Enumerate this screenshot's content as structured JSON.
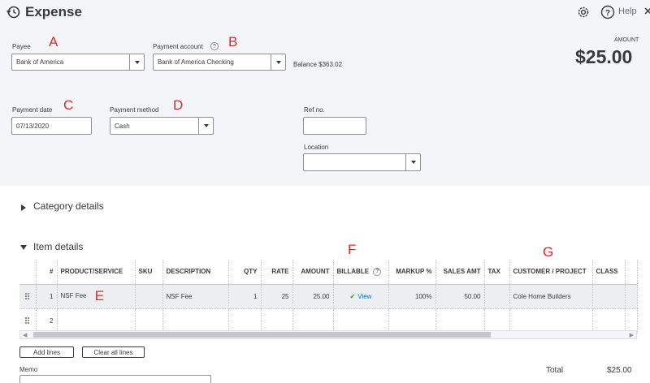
{
  "header": {
    "title": "Expense",
    "help_label": "Help",
    "icons": [
      "history-icon",
      "gear-icon",
      "help-icon",
      "close-icon"
    ]
  },
  "payee": {
    "label": "Payee",
    "value": "Bank of America"
  },
  "payment_account": {
    "label": "Payment account",
    "value": "Bank of America Checking",
    "help": "?"
  },
  "balance": "Balance $363.02",
  "amount": {
    "label": "AMOUNT",
    "value": "$25.00"
  },
  "payment_date": {
    "label": "Payment date",
    "value": "07/13/2020"
  },
  "payment_method": {
    "label": "Payment method",
    "value": "Cash"
  },
  "ref_no": {
    "label": "Ref no.",
    "value": ""
  },
  "location": {
    "label": "Location",
    "value": ""
  },
  "annotations": {
    "a": "A",
    "b": "B",
    "c": "C",
    "d": "D",
    "e": "E",
    "f": "F",
    "g": "G"
  },
  "category_details": {
    "title": "Category details"
  },
  "item_details": {
    "title": "Item details",
    "columns": [
      "#",
      "PRODUCT/SERVICE",
      "SKU",
      "DESCRIPTION",
      "QTY",
      "RATE",
      "AMOUNT",
      "BILLABLE",
      "MARKUP %",
      "SALES AMT",
      "TAX",
      "CUSTOMER / PROJECT",
      "CLASS"
    ],
    "billable_help": "?",
    "rows": [
      {
        "num": "1",
        "product": "NSF Fee",
        "sku": "",
        "description": "NSF Fee",
        "qty": "1",
        "rate": "25",
        "amount": "25.00",
        "billable": "View",
        "markup": "100%",
        "sales_amt": "50.00",
        "tax": "",
        "customer": "Cole Home Builders",
        "class": ""
      },
      {
        "num": "2",
        "product": "",
        "sku": "",
        "description": "",
        "qty": "",
        "rate": "",
        "amount": "",
        "billable": "",
        "markup": "",
        "sales_amt": "",
        "tax": "",
        "customer": "",
        "class": ""
      }
    ]
  },
  "buttons": {
    "add_lines": "Add lines",
    "clear_all_lines": "Clear all lines"
  },
  "memo": {
    "label": "Memo"
  },
  "total": {
    "label": "Total",
    "value": "$25.00"
  },
  "colors": {
    "top_background": "#f4f5f8",
    "annotation": "#e0282c",
    "link": "#0077c5",
    "check": "#2ca01c"
  }
}
